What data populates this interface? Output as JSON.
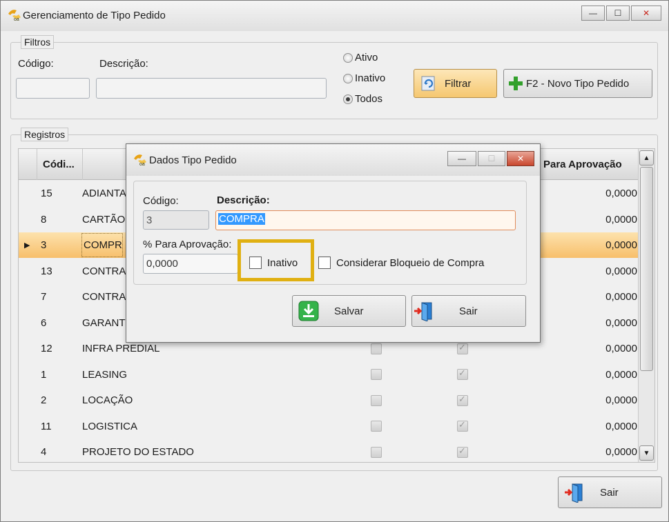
{
  "window": {
    "title": "Gerenciamento de Tipo Pedido",
    "minimize_glyph": "—",
    "maximize_glyph": "☐",
    "close_glyph": "✕"
  },
  "filters": {
    "group_label": "Filtros",
    "codigo_label": "Código:",
    "codigo_value": "",
    "descricao_label": "Descrição:",
    "descricao_value": "",
    "radio_ativo": "Ativo",
    "radio_inativo": "Inativo",
    "radio_todos": "Todos",
    "selected": "Todos",
    "filter_button": "Filtrar",
    "new_button": "F2 - Novo Tipo Pedido"
  },
  "registros": {
    "group_label": "Registros",
    "columns": {
      "codigo": "Códi...",
      "aprovacao": "Para Aprovação"
    },
    "rows": [
      {
        "codigo": "15",
        "descricao": "ADIANTA",
        "col1": false,
        "col2": false,
        "aprovacao": "0,0000",
        "selected": false
      },
      {
        "codigo": "8",
        "descricao": "CARTÃO",
        "col1": false,
        "col2": false,
        "aprovacao": "0,0000",
        "selected": false
      },
      {
        "codigo": "3",
        "descricao": "COMPR",
        "col1": false,
        "col2": false,
        "aprovacao": "0,0000",
        "selected": true
      },
      {
        "codigo": "13",
        "descricao": "CONTRA",
        "col1": false,
        "col2": false,
        "aprovacao": "0,0000",
        "selected": false
      },
      {
        "codigo": "7",
        "descricao": "CONTRA",
        "col1": false,
        "col2": false,
        "aprovacao": "0,0000",
        "selected": false
      },
      {
        "codigo": "6",
        "descricao": "GARANT",
        "col1": false,
        "col2": false,
        "aprovacao": "0,0000",
        "selected": false
      },
      {
        "codigo": "12",
        "descricao": "INFRA PREDIAL",
        "col1": false,
        "col2": true,
        "aprovacao": "0,0000",
        "selected": false
      },
      {
        "codigo": "1",
        "descricao": "LEASING",
        "col1": false,
        "col2": true,
        "aprovacao": "0,0000",
        "selected": false
      },
      {
        "codigo": "2",
        "descricao": "LOCAÇÃO",
        "col1": false,
        "col2": true,
        "aprovacao": "0,0000",
        "selected": false
      },
      {
        "codigo": "11",
        "descricao": "LOGISTICA",
        "col1": false,
        "col2": true,
        "aprovacao": "0,0000",
        "selected": false
      },
      {
        "codigo": "4",
        "descricao": "PROJETO DO ESTADO",
        "col1": false,
        "col2": true,
        "aprovacao": "0,0000",
        "selected": false
      }
    ]
  },
  "dialog": {
    "title": "Dados Tipo Pedido",
    "codigo_label": "Código:",
    "codigo_value": "3",
    "descricao_label": "Descrição:",
    "descricao_value": "COMPRA",
    "aprovacao_label": "% Para Aprovação:",
    "aprovacao_value": "0,0000",
    "inativo_label": "Inativo",
    "bloqueio_label": "Considerar Bloqueio de Compra",
    "salvar_button": "Salvar",
    "sair_button": "Sair"
  },
  "footer": {
    "sair_button": "Sair"
  },
  "colors": {
    "accent_orange": "#f7bf6b",
    "highlight": "#e0b012",
    "selection_blue": "#3399ff"
  }
}
